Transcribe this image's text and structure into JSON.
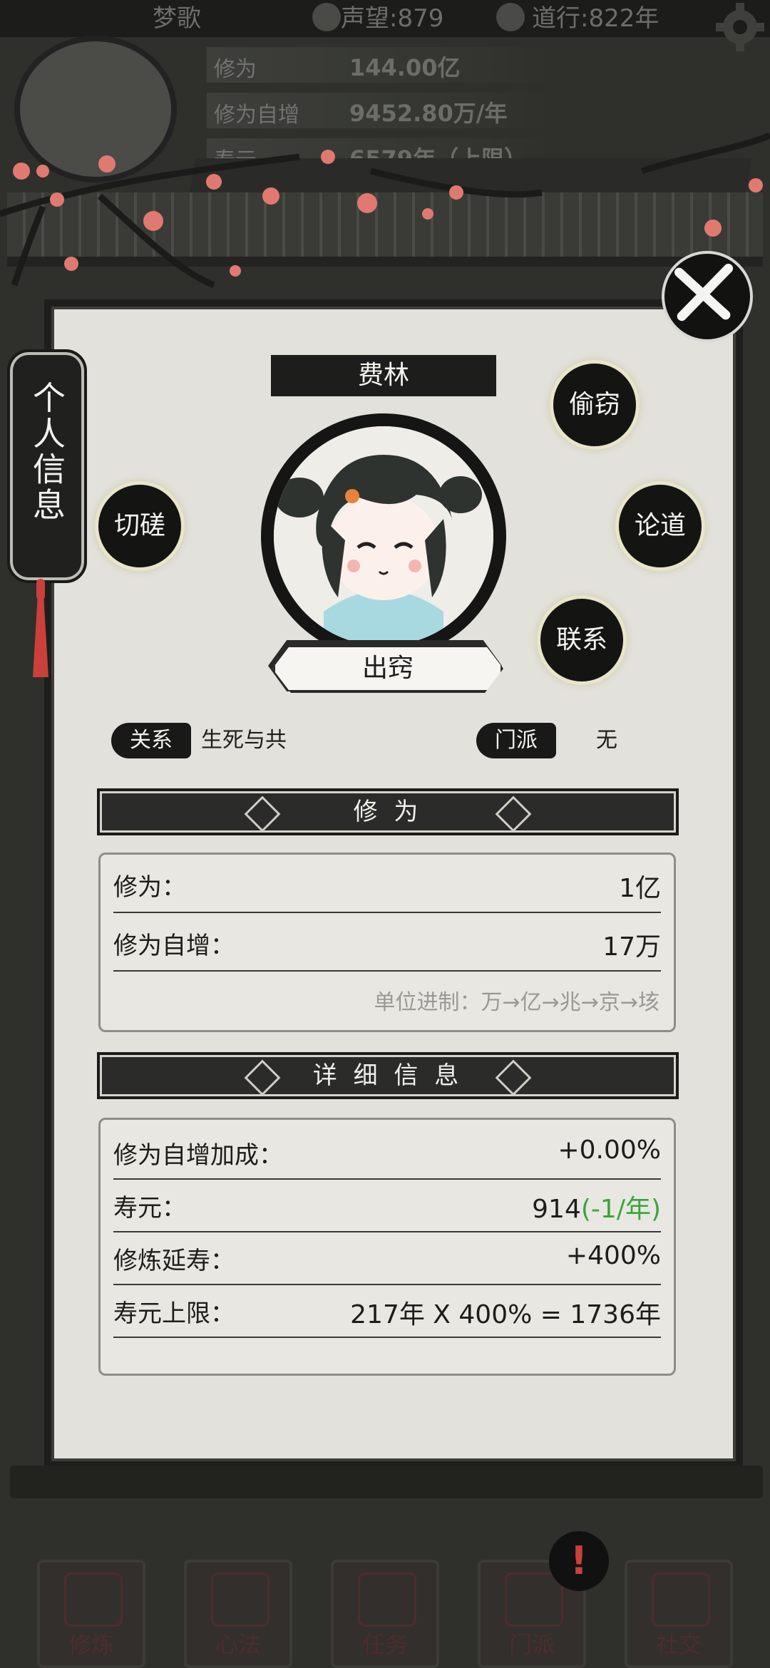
{
  "hud": {
    "player_name": "梦歌",
    "reputation": "声望:879",
    "daoxing": "道行:822年"
  },
  "background_stats": [
    {
      "label": "修为",
      "value": "144.00亿"
    },
    {
      "label": "修为自增",
      "value": "9452.80万/年"
    },
    {
      "label": "寿元",
      "value": "6579年（上限）"
    }
  ],
  "side_tab": "个人信息",
  "character": {
    "name": "费林",
    "realm": "出窍",
    "relation_label": "关系",
    "relation_value": "生死与共",
    "sect_label": "门派",
    "sect_value": "无"
  },
  "actions": {
    "spar": "切磋",
    "steal": "偷窃",
    "discuss": "论道",
    "contact": "联系"
  },
  "cultivation": {
    "header": "修 为",
    "rows": [
      {
        "label": "修为：",
        "value": "1亿"
      },
      {
        "label": "修为自增：",
        "value": "17万"
      }
    ],
    "note": "单位进制：万→亿→兆→京→垓"
  },
  "details": {
    "header": "详 细 信 息",
    "bonus_label": "修为自增加成：",
    "bonus_value": "+0.00%",
    "life_label": "寿元：",
    "life_value": "914",
    "life_change": "(-1/年)",
    "extend_label": "修炼延寿：",
    "extend_value": "+400%",
    "limit_label": "寿元上限：",
    "limit_value": "217年 X 400% = 1736年"
  },
  "nav": [
    "修炼",
    "心法",
    "任务",
    "门派",
    "社交"
  ],
  "alert": "!",
  "colors": {
    "accent_red": "#c9413a",
    "life_change_green": "#3aa53a",
    "ink_black": "#141413",
    "paper": "#e3e1db"
  }
}
